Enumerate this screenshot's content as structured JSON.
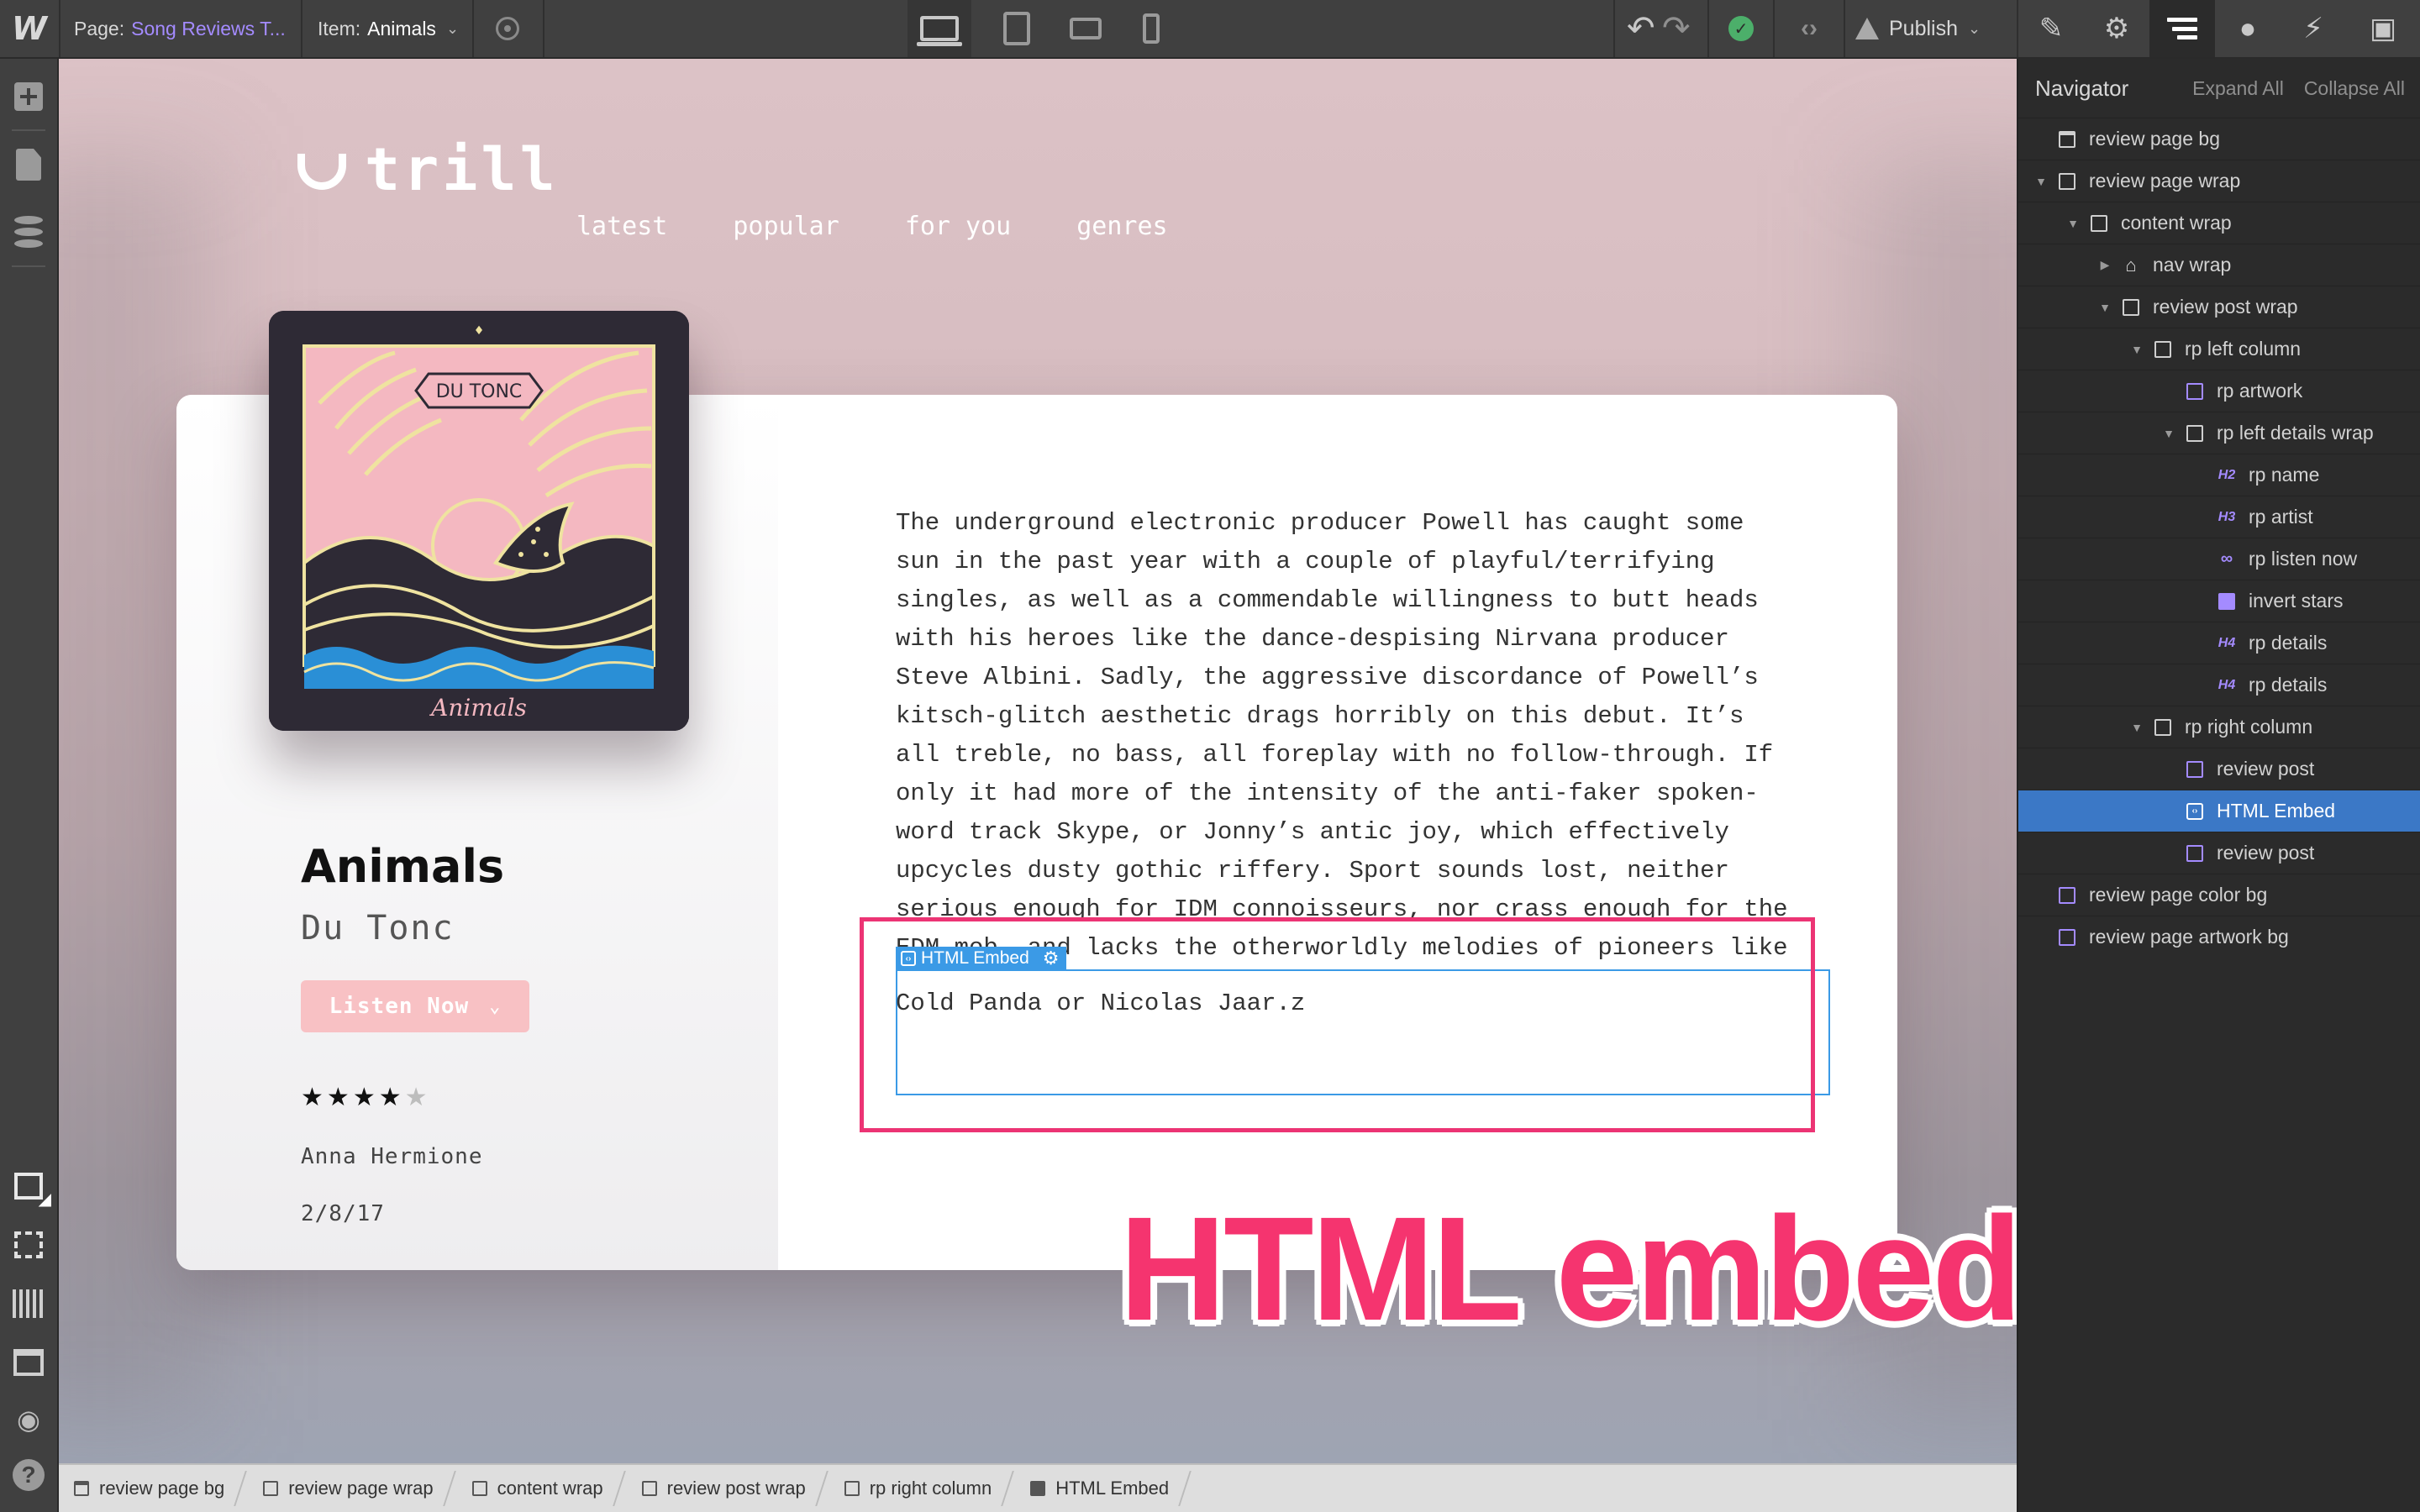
{
  "app": {
    "logo": "W"
  },
  "toolbar": {
    "page_label": "Page:",
    "page_value": "Song Reviews T...",
    "item_label": "Item:",
    "item_value": "Animals",
    "publish_label": "Publish",
    "devices": [
      "desktop",
      "tablet",
      "mobile-landscape",
      "mobile-portrait"
    ],
    "active_device": "desktop",
    "status": "saved"
  },
  "site": {
    "logo_text": "trill",
    "nav": [
      "latest",
      "popular",
      "for you",
      "genres"
    ]
  },
  "artwork": {
    "album_badge": "DU TONC",
    "album_script": "Animals",
    "colors": {
      "sky": "#f4b8c1",
      "hills": "#2e2a35",
      "lines": "#efe3a0",
      "water": "#2a8fd6"
    }
  },
  "review": {
    "name": "Animals",
    "artist": "Du Tonc",
    "listen_label": "Listen Now",
    "rating": 4,
    "rating_max": 5,
    "author": "Anna Hermione",
    "date": "2/8/17",
    "body_lines": [
      "The underground electronic producer Powell has caught some",
      "sun in the past year with a couple of playful/terrifying",
      "singles, as well as a commendable willingness to butt heads",
      "with his heroes like the dance-despising Nirvana producer",
      "Steve Albini. Sadly, the aggressive discordance of Powell’s",
      "kitsch-glitch aesthetic drags horribly on this debut. It’s",
      "all treble, no bass, all foreplay with no follow-through. If",
      "only it had more of the intensity of the anti-faker spoken-",
      "word track Skype, or Jonny’s antic joy, which effectively",
      "upcycles dusty gothic riffery. Sport sounds lost, neither",
      "serious enough for IDM connoisseurs, nor crass enough for the",
      "EDM mob, and lacks the otherworldly melodies of pioneers like"
    ],
    "body_last_line": "Cold Panda or Nicolas Jaar.z"
  },
  "embed": {
    "label": "HTML Embed",
    "annotation": "HTML embed",
    "highlight_color": "#ec3474"
  },
  "navigator": {
    "title": "Navigator",
    "expand_all": "Expand All",
    "collapse_all": "Collapse All",
    "tree": [
      {
        "label": "review page bg",
        "icon": "bg-box",
        "caret": "none",
        "depth": 0
      },
      {
        "label": "review page wrap",
        "icon": "box",
        "caret": "open",
        "depth": 0
      },
      {
        "label": "content wrap",
        "icon": "box",
        "caret": "open",
        "depth": 1
      },
      {
        "label": "nav wrap",
        "icon": "home",
        "caret": "closed",
        "depth": 2
      },
      {
        "label": "review post wrap",
        "icon": "box",
        "caret": "open",
        "depth": 2
      },
      {
        "label": "rp left column",
        "icon": "box",
        "caret": "open",
        "depth": 3
      },
      {
        "label": "rp artwork",
        "icon": "box-purple",
        "caret": "none",
        "depth": 4
      },
      {
        "label": "rp left details wrap",
        "icon": "box",
        "caret": "open",
        "depth": 4
      },
      {
        "label": "rp name",
        "icon": "H2",
        "caret": "none",
        "depth": 5
      },
      {
        "label": "rp artist",
        "icon": "H3",
        "caret": "none",
        "depth": 5
      },
      {
        "label": "rp listen now",
        "icon": "link",
        "caret": "none",
        "depth": 5
      },
      {
        "label": "invert stars",
        "icon": "image",
        "caret": "none",
        "depth": 5
      },
      {
        "label": "rp details",
        "icon": "H4",
        "caret": "none",
        "depth": 5
      },
      {
        "label": "rp details",
        "icon": "H4",
        "caret": "none",
        "depth": 5
      },
      {
        "label": "rp right column",
        "icon": "box",
        "caret": "open",
        "depth": 3
      },
      {
        "label": "review post",
        "icon": "box-purple",
        "caret": "none",
        "depth": 4
      },
      {
        "label": "HTML Embed",
        "icon": "embed",
        "caret": "none",
        "depth": 4,
        "selected": true
      },
      {
        "label": "review post",
        "icon": "box-purple",
        "caret": "none",
        "depth": 4
      },
      {
        "label": "review page color bg",
        "icon": "box-purple",
        "caret": "none",
        "depth": 0
      },
      {
        "label": "review page artwork bg",
        "icon": "box-purple",
        "caret": "none",
        "depth": 0
      }
    ]
  },
  "breadcrumbs": [
    {
      "label": "review page bg",
      "icon": "bg"
    },
    {
      "label": "review page wrap",
      "icon": "box"
    },
    {
      "label": "content wrap",
      "icon": "box"
    },
    {
      "label": "review post wrap",
      "icon": "box"
    },
    {
      "label": "rp right column",
      "icon": "box"
    },
    {
      "label": "HTML Embed",
      "icon": "embed"
    }
  ]
}
